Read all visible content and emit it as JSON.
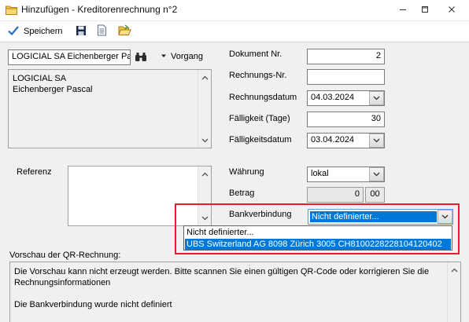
{
  "window": {
    "title": "Hinzufügen - Kreditorenrechnung n°2",
    "icons": [
      "app-folder-icon",
      "minimize-icon",
      "restore-icon",
      "close-icon"
    ]
  },
  "toolbar": {
    "save_label": "Speichern",
    "icons": [
      "checkmark-icon",
      "floppy-disk-icon",
      "document-icon",
      "open-folder-icon"
    ]
  },
  "creditor": {
    "value": "LOGICIAL SA Eichenberger Pa:",
    "binoculars_icon": "binoculars-icon",
    "vorgang_label": "Vorgang",
    "address_line1": "LOGICIAL SA",
    "address_line2": "Eichenberger Pascal"
  },
  "fields": {
    "dokument_nr_label": "Dokument Nr.",
    "dokument_nr_value": "2",
    "rechnungs_nr_label": "Rechnungs-Nr.",
    "rechnungs_nr_value": "",
    "rechnungsdatum_label": "Rechnungsdatum",
    "rechnungsdatum_value": "04.03.2024",
    "faelligkeit_label": "Fälligkeit (Tage)",
    "faelligkeit_value": "30",
    "faelligkeitsdatum_label": "Fälligkeitsdatum",
    "faelligkeitsdatum_value": "03.04.2024"
  },
  "referenz": {
    "label": "Referenz",
    "value": ""
  },
  "waehrung": {
    "label": "Währung",
    "value": "lokal"
  },
  "betrag": {
    "label": "Betrag",
    "amount": "0",
    "cents": "00"
  },
  "bankverbindung": {
    "label": "Bankverbindung",
    "selected": "Nicht definierter...",
    "options": [
      "Nicht definierter...",
      "UBS Switzerland AG 8098 Zürich 3005 CH8100228228104120402"
    ],
    "highlighted_index": 1
  },
  "qr_preview": {
    "label": "Vorschau der QR-Rechnung:",
    "line1": "Die Vorschau kann nicht erzeugt werden. Bitte scannen Sie einen gültigen QR-Code oder korrigieren Sie die",
    "line2": "Rechnungsinformationen",
    "line3": "Die Bankverbindung wurde nicht definiert"
  },
  "colors": {
    "selection": "#0078d7",
    "highlight_frame": "#e41e2b",
    "form_background": "#f0f0f0"
  }
}
